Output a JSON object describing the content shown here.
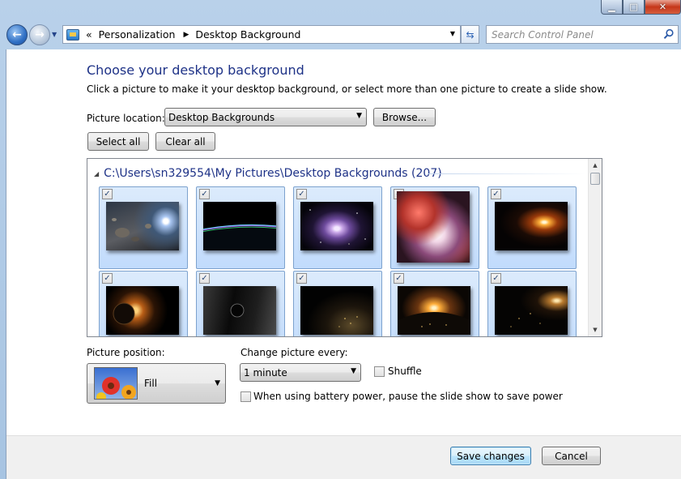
{
  "window": {
    "minimize_icon": "minimize-icon",
    "maximize_icon": "maximize-icon",
    "close_icon": "close-icon"
  },
  "navigation": {
    "breadcrumb_overflow": "«",
    "breadcrumbs": [
      "Personalization",
      "Desktop Background"
    ],
    "search_placeholder": "Search Control Panel"
  },
  "page": {
    "title": "Choose your desktop background",
    "description": "Click a picture to make it your desktop background, or select more than one picture to create a slide show."
  },
  "location": {
    "label": "Picture location:",
    "selected": "Desktop Backgrounds",
    "browse_label": "Browse..."
  },
  "selection": {
    "select_all_label": "Select all",
    "clear_all_label": "Clear all"
  },
  "gallery": {
    "group_header": "C:\\Users\\sn329554\\My Pictures\\Desktop Backgrounds (207)",
    "tiles": [
      {
        "checked": true,
        "name": "asteroid belt near star"
      },
      {
        "checked": true,
        "name": "earth horizon at night"
      },
      {
        "checked": true,
        "name": "spiral galaxy"
      },
      {
        "checked": true,
        "name": "nebula"
      },
      {
        "checked": true,
        "name": "sunrise over planet"
      },
      {
        "checked": true,
        "name": "planet with moon"
      },
      {
        "checked": true,
        "name": "dark planet eclipse"
      },
      {
        "checked": true,
        "name": "city lights from orbit"
      },
      {
        "checked": true,
        "name": "sun rising over earth"
      },
      {
        "checked": true,
        "name": "earth at night"
      }
    ]
  },
  "position": {
    "label": "Picture position:",
    "selected": "Fill"
  },
  "slideshow": {
    "interval_label": "Change picture every:",
    "interval_selected": "1 minute",
    "shuffle_label": "Shuffle",
    "shuffle_checked": false,
    "battery_label": "When using battery power, pause the slide show to save power",
    "battery_checked": false
  },
  "footer": {
    "save_label": "Save changes",
    "cancel_label": "Cancel"
  }
}
